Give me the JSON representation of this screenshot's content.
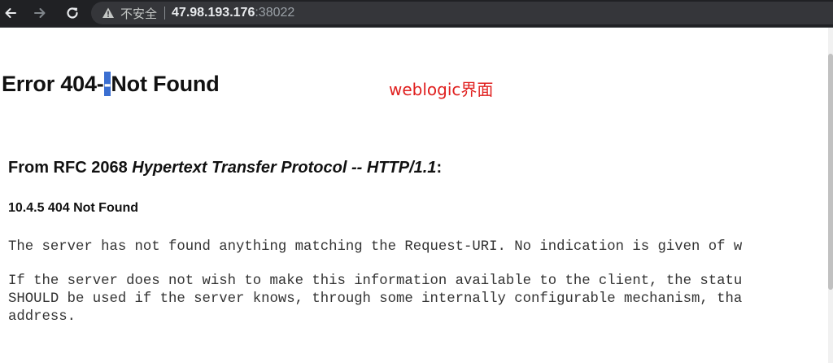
{
  "browser": {
    "back_icon": "arrow-left-icon",
    "forward_icon": "arrow-right-icon",
    "reload_icon": "reload-icon",
    "security_icon": "warning-triangle-icon",
    "security_label": "不安全",
    "url_host": "47.98.193.176",
    "url_port": ":38022"
  },
  "page": {
    "title_prefix": "Error 404-",
    "title_selected": "-",
    "title_suffix": "Not Found",
    "annotation": "weblogic界面",
    "rfc_prefix": "From RFC 2068 ",
    "rfc_italic": "Hypertext Transfer Protocol -- HTTP/1.1",
    "rfc_suffix": ":",
    "subheading": "10.4.5 404 Not Found",
    "paragraph1": "The server has not found anything matching the Request-URI. No indication is given of w",
    "paragraph2_line1": "If the server does not wish to make this information available to the client, the statu",
    "paragraph2_line2": "SHOULD be used if the server knows, through some internally configurable mechanism, tha",
    "paragraph2_line3": "address."
  },
  "colors": {
    "toolbar_bg": "#202124",
    "omnibox_bg": "#35363a",
    "selection": "#3b6fd1",
    "annotation": "#e0201f"
  }
}
